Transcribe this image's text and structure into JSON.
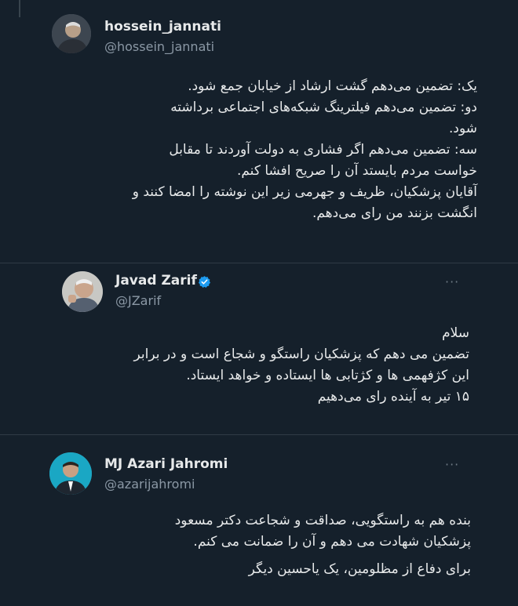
{
  "tweets": [
    {
      "name": "hossein_jannati",
      "handle": "@hossein_jannati",
      "lines": [
        "یک: تضمین می‌دهم گشت ارشاد از خیابان جمع شود.",
        "دو: تضمین می‌دهم فیلترینگ شبکه‌های اجتماعی برداشته",
        "شود.",
        "سه: تضمین می‌دهم اگر فشاری به دولت آوردند تا مقابل",
        "خواست مردم بایستد آن را صریح افشا کنم.",
        "آقایان پزشکیان، ظریف و جهرمی زیر این نوشته را امضا کنند و",
        "انگشت بزنند من رای می‌دهم."
      ]
    },
    {
      "name": "Javad Zarif",
      "handle": "@JZarif",
      "verified": true,
      "lines": [
        "سلام",
        "تضمین می دهم که پزشکیان راستگو و شجاع است و  در برابر",
        "این کژفهمی ها و کژتابی ها ایستاده و خواهد ایستاد.",
        "۱۵ تیر به آینده رای می‌دهیم"
      ]
    },
    {
      "name": "MJ Azari Jahromi",
      "handle": "@azarijahromi",
      "lines": [
        "بنده هم به راستگویی، صداقت و شجاعت دکتر مسعود",
        "پزشکیان شهادت می دهم و آن را ضمانت می کنم.",
        "برای دفاع از مظلومین، یک یاحسین دیگر"
      ]
    }
  ],
  "more_icon": "···",
  "colors": {
    "background": "#15202b",
    "verified": "#1d9bf0",
    "text": "#e7e9ea",
    "muted": "#8b98a5"
  }
}
